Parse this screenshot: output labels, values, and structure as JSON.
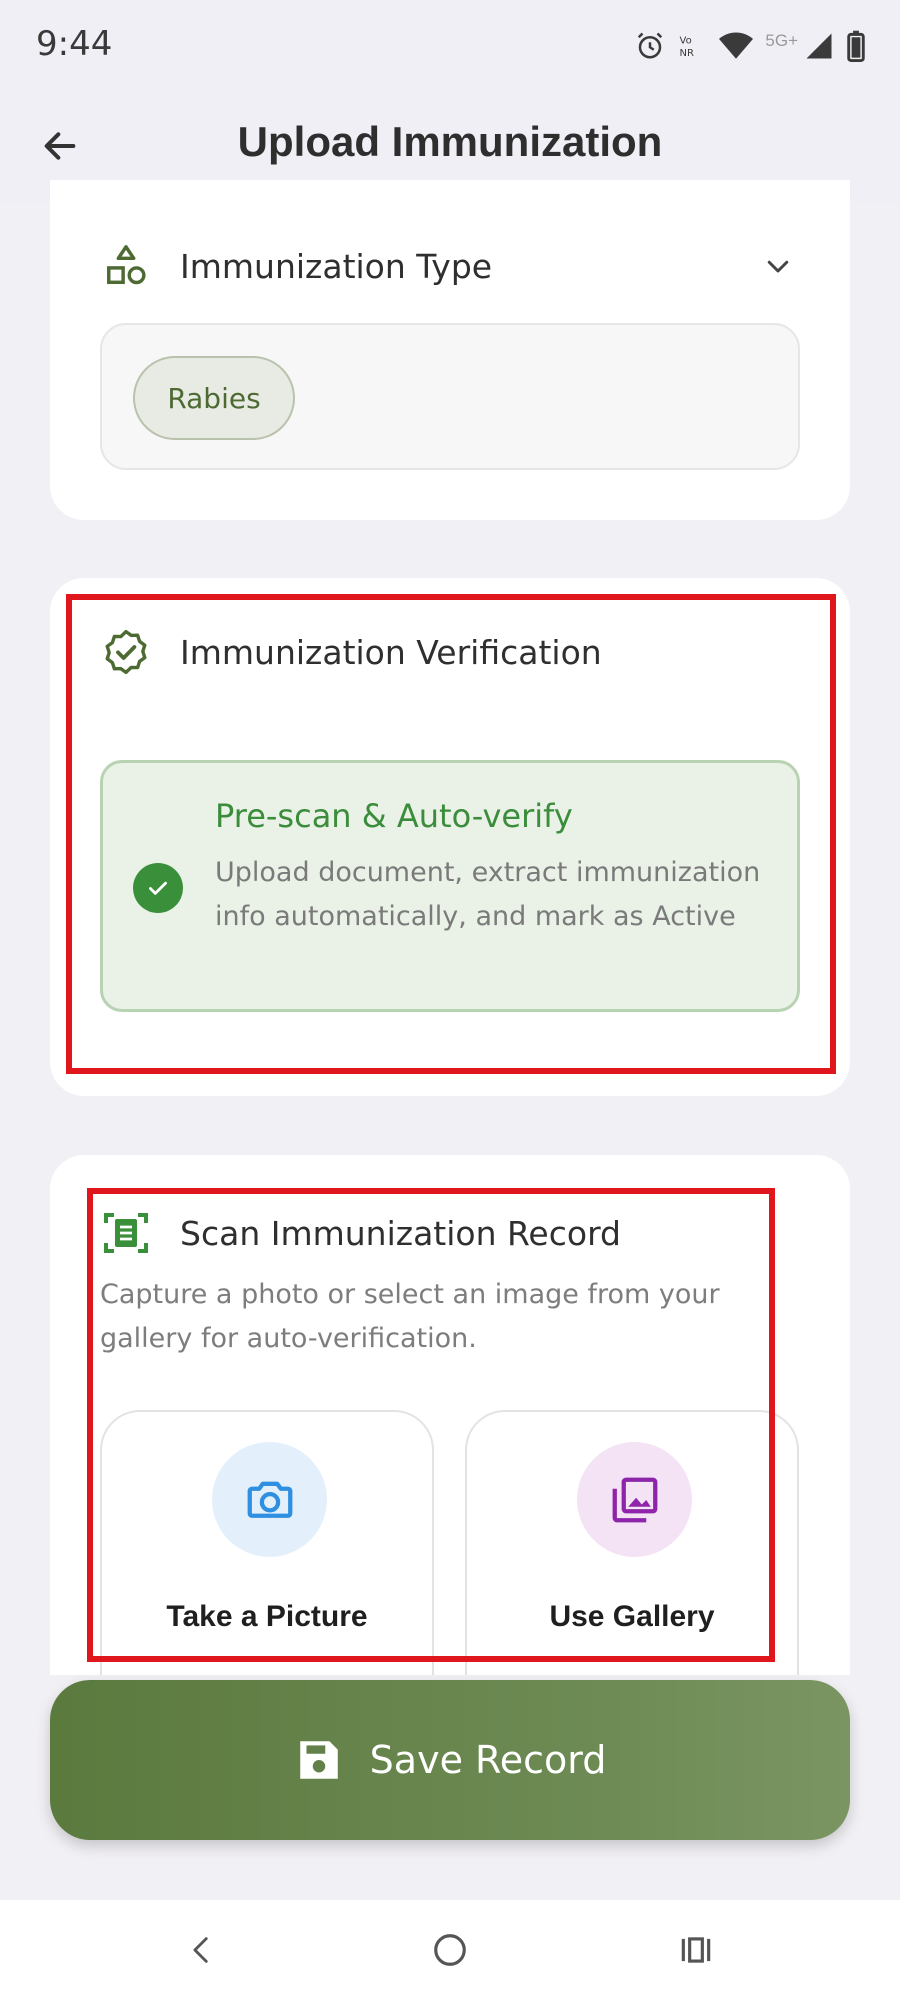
{
  "status_bar": {
    "time": "9:44",
    "network_label": "5G+",
    "icons": [
      "alarm-icon",
      "volte-icon",
      "wifi-icon",
      "signal-icon",
      "battery-icon"
    ]
  },
  "app_bar": {
    "title": "Upload Immunization",
    "back_icon": "arrow-left-icon"
  },
  "immunization_type": {
    "title": "Immunization Type",
    "icon": "shapes-icon",
    "selected": "Rabies"
  },
  "verification": {
    "title": "Immunization Verification",
    "icon": "verified-badge-icon",
    "option_title": "Pre-scan & Auto-verify",
    "option_desc": "Upload document, extract immunization info automatically, and mark as Active"
  },
  "scan": {
    "title": "Scan Immunization Record",
    "icon": "document-scanner-icon",
    "description": "Capture a photo or select an image from your gallery for auto-verification.",
    "take_picture_label": "Take a Picture",
    "use_gallery_label": "Use Gallery"
  },
  "save": {
    "label": "Save Record",
    "icon": "save-icon"
  },
  "colors": {
    "accent_green": "#5b7a3e",
    "success_green": "#3a8f3a",
    "highlight_red": "#e0161d",
    "camera_blue": "#2f8fe0",
    "gallery_purple": "#8e24aa"
  }
}
